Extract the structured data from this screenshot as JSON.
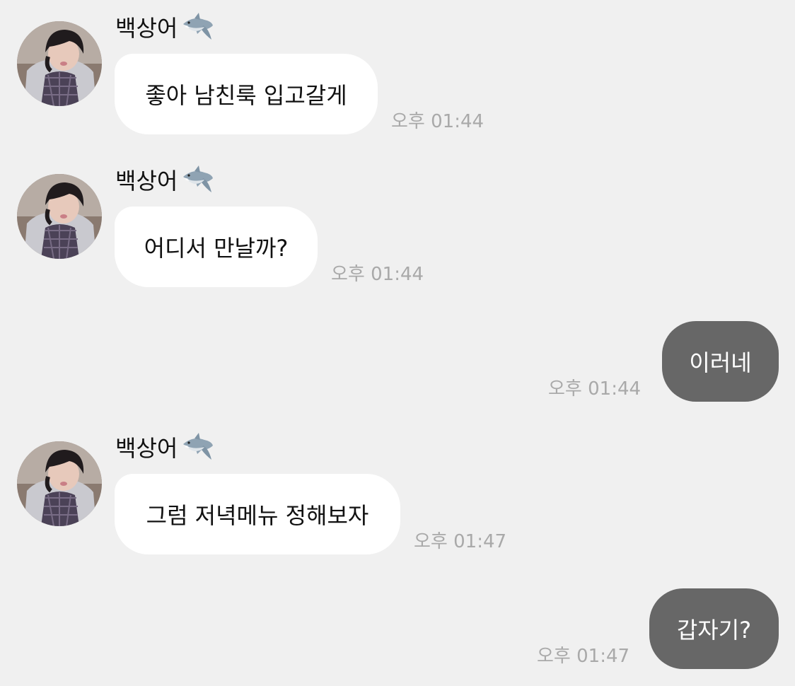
{
  "messages": [
    {
      "sender": "백상어",
      "text": "좋아 남친룩 입고갈게",
      "time": "오후 01:44"
    },
    {
      "sender": "백상어",
      "text": "어디서 만날까?",
      "time": "오후 01:44"
    },
    {
      "text": "이러네",
      "time": "오후 01:44"
    },
    {
      "sender": "백상어",
      "text": "그럼 저녁메뉴 정해보자",
      "time": "오후 01:47"
    },
    {
      "text": "갑자기?",
      "time": "오후 01:47"
    }
  ],
  "icons": {
    "sender_emoji": "shark-icon",
    "avatar": "profile-photo"
  },
  "colors": {
    "background": "#f0f0f0",
    "incoming_bubble": "#ffffff",
    "outgoing_bubble": "#676767",
    "timestamp": "#a9a9a9"
  }
}
